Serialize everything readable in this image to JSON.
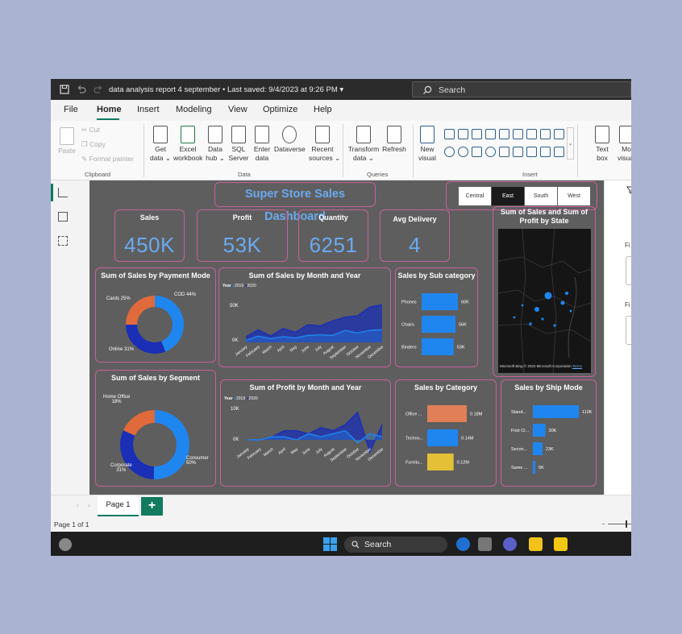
{
  "window": {
    "title": "data analysis report 4 september • Last saved: 9/4/2023 at 9:26 PM",
    "search_placeholder": "Search"
  },
  "menu": {
    "tabs": [
      "File",
      "Home",
      "Insert",
      "Modeling",
      "View",
      "Optimize",
      "Help"
    ],
    "active": "Home"
  },
  "ribbon": {
    "clipboard": {
      "paste": "Paste",
      "cut": "Cut",
      "copy": "Copy",
      "format_painter": "Format painter",
      "group": "Clipboard"
    },
    "data": {
      "get_data": [
        "Get",
        "data ⌄"
      ],
      "excel": [
        "Excel",
        "workbook"
      ],
      "data_hub": [
        "Data",
        "hub ⌄"
      ],
      "sql": [
        "SQL",
        "Server"
      ],
      "enter": [
        "Enter",
        "data"
      ],
      "dataverse": "Dataverse",
      "recent": [
        "Recent",
        "sources ⌄"
      ],
      "group": "Data"
    },
    "queries": {
      "transform": [
        "Transform",
        "data ⌄"
      ],
      "refresh": "Refresh",
      "group": "Queries"
    },
    "insert": {
      "new_visual": [
        "New",
        "visual"
      ],
      "text_box": [
        "Text",
        "box"
      ],
      "more": [
        "Mo",
        "visual"
      ],
      "group": "Insert"
    }
  },
  "dashboard": {
    "title": "Super Store Sales Dashboard",
    "slicer": [
      "Central",
      "East",
      "South",
      "West"
    ],
    "slicer_selected": "East",
    "kpis": [
      {
        "label": "Sales",
        "value": "450K"
      },
      {
        "label": "Profit",
        "value": "53K"
      },
      {
        "label": "Quantity",
        "value": "6251"
      },
      {
        "label": "Avg Delivery",
        "value": "4"
      }
    ],
    "map": {
      "title_line1": "Sum of Sales and Sum of",
      "title_line2": "Profit by State",
      "copyright": "© 2023 Microsoft Corporation",
      "terms": "Terms",
      "brand": "Microsoft Bing"
    }
  },
  "chart_data": [
    {
      "type": "pie",
      "title": "Sum of Sales by Payment Mode",
      "labels": [
        "COD",
        "Online",
        "Cards"
      ],
      "values": [
        44,
        31,
        25
      ],
      "data_labels": [
        "COD 44%",
        "Online 31%",
        "Cards 25%"
      ],
      "colors": [
        "#1f86f0",
        "#1a2fb5",
        "#e06a3b"
      ]
    },
    {
      "type": "area",
      "title": "Sum of Sales by Month and Year",
      "legend_title": "Year",
      "x": [
        "January",
        "February",
        "March",
        "April",
        "May",
        "June",
        "July",
        "August",
        "September",
        "October",
        "November",
        "December"
      ],
      "series": [
        {
          "name": "2019",
          "color": "#1f86f0",
          "values": [
            3,
            10,
            6,
            9,
            7,
            11,
            12,
            11,
            19,
            15,
            19,
            20
          ]
        },
        {
          "name": "2020",
          "color": "#1a2fb5",
          "values": [
            9,
            20,
            10,
            22,
            16,
            28,
            26,
            34,
            40,
            42,
            56,
            60
          ]
        }
      ],
      "ytick_labels": [
        "0K",
        "50K"
      ],
      "ylim": [
        0,
        60
      ]
    },
    {
      "type": "bar",
      "title": "Sales by Sub category",
      "categories": [
        "Phones",
        "Chairs",
        "Binders"
      ],
      "values": [
        60,
        56,
        53
      ],
      "data_labels": [
        "60K",
        "56K",
        "53K"
      ],
      "color": "#1f86f0"
    },
    {
      "type": "pie",
      "title": "Sum of Sales by Segment",
      "labels": [
        "Consumer",
        "Corporate",
        "Home Office"
      ],
      "values": [
        50,
        31,
        18
      ],
      "data_labels": [
        "Consumer\n50%",
        "Corporate\n31%",
        "Home Office\n18%"
      ],
      "colors": [
        "#1f86f0",
        "#1a2fb5",
        "#e06a3b"
      ]
    },
    {
      "type": "area",
      "title": "Sum of Profit by Month and Year",
      "legend_title": "Year",
      "x": [
        "January",
        "February",
        "March",
        "April",
        "May",
        "June",
        "July",
        "August",
        "September",
        "October",
        "November",
        "December"
      ],
      "series": [
        {
          "name": "2019",
          "color": "#1f86f0",
          "values": [
            0,
            0,
            1,
            1,
            0,
            2,
            1,
            2,
            3,
            -1,
            2,
            1
          ]
        },
        {
          "name": "2020",
          "color": "#1a2fb5",
          "values": [
            0,
            0,
            1,
            3,
            3,
            2,
            4,
            3,
            5,
            9,
            -4,
            5
          ]
        }
      ],
      "ytick_labels": [
        "0K",
        "10K"
      ],
      "ylim": [
        -5,
        10
      ]
    },
    {
      "type": "bar",
      "title": "Sales by Category",
      "categories": [
        "Office ...",
        "Techno...",
        "Furnitu..."
      ],
      "values": [
        0.18,
        0.14,
        0.12
      ],
      "data_labels": [
        "0.18M",
        "0.14M",
        "0.12M"
      ],
      "colors": [
        "#e07f58",
        "#1f86f0",
        "#e4c036"
      ]
    },
    {
      "type": "bar",
      "title": "Sales by Ship Mode",
      "categories": [
        "Stand...",
        "First Cl...",
        "Secon...",
        "Same ..."
      ],
      "values": [
        110,
        30,
        23,
        6
      ],
      "data_labels": [
        "110K",
        "30K",
        "23K",
        "6K"
      ],
      "color": "#1f86f0"
    }
  ],
  "right_pane": {
    "label1": "Fi",
    "label2": "Fi"
  },
  "pages": {
    "tab": "Page 1",
    "add": "+"
  },
  "status": {
    "page": "Page 1 of 1"
  },
  "taskbar": {
    "search": "Search"
  }
}
